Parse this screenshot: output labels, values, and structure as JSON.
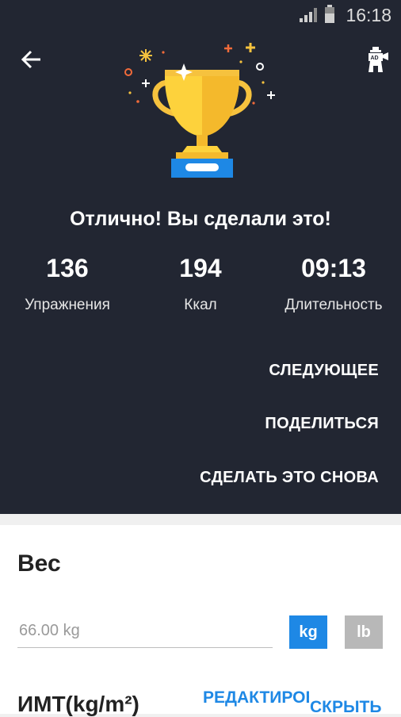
{
  "status_bar": {
    "time": "16:18"
  },
  "header": {
    "back_icon": "arrow-left-icon",
    "ad_icon": "ad-lighthouse-icon",
    "trophy_icon": "trophy-icon"
  },
  "result": {
    "headline": "Отлично! Вы сделали это!",
    "stats": [
      {
        "value": "136",
        "label": "Упражнения"
      },
      {
        "value": "194",
        "label": "Ккал"
      },
      {
        "value": "09:13",
        "label": "Длительность"
      }
    ]
  },
  "actions": {
    "next": "СЛЕДУЮЩЕЕ",
    "share": "ПОДЕЛИТЬСЯ",
    "repeat": "СДЕЛАТЬ ЭТО СНОВА"
  },
  "weight": {
    "title": "Вес",
    "value": "66.00 kg",
    "unit_kg": "kg",
    "unit_lb": "lb",
    "selected_unit": "kg"
  },
  "bmi": {
    "title": "ИМТ(kg/m²)",
    "edit_label": "РЕДАКТИРОВАТЬ",
    "hide_label": "СКРЫТЬ"
  },
  "colors": {
    "dark_bg": "#222632",
    "accent_blue": "#1e88e5",
    "inactive_gray": "#b8b8b8"
  }
}
